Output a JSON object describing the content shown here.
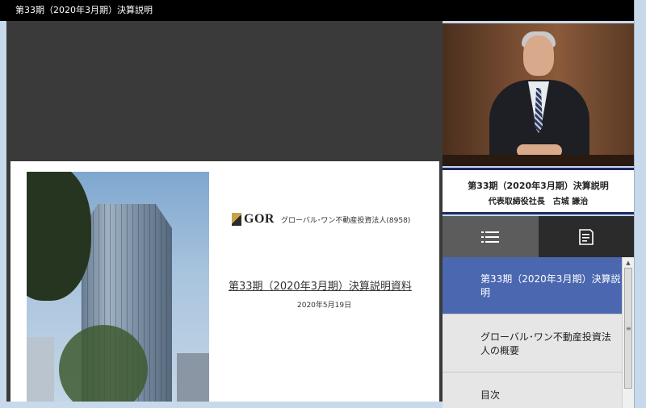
{
  "window": {
    "title": "第33期（2020年3月期）決算説明"
  },
  "slide": {
    "logo_text": "GOR",
    "company": "グローバル･ワン不動産投資法人",
    "ticker": "(8958)",
    "title": "第33期（2020年3月期）決算説明資料",
    "date": "2020年5月19日"
  },
  "video": {
    "caption_line1": "第33期（2020年3月期）決算説明",
    "caption_line2": "代表取締役社長　古城 謙治"
  },
  "tabs": [
    {
      "name": "tab-chapters",
      "icon": "list-icon"
    },
    {
      "name": "tab-notes",
      "icon": "notes-icon"
    }
  ],
  "toc": {
    "items": [
      {
        "line1": "第33期（2020年3月期）決算説",
        "line2": "明",
        "active": true
      },
      {
        "line1": "グローバル･ワン不動産投資法",
        "line2": "人の概要",
        "active": false
      },
      {
        "line1": "目次",
        "line2": "",
        "active": false
      }
    ]
  },
  "colors": {
    "accent": "#4a67b0",
    "caption_border": "#1c2a66"
  }
}
